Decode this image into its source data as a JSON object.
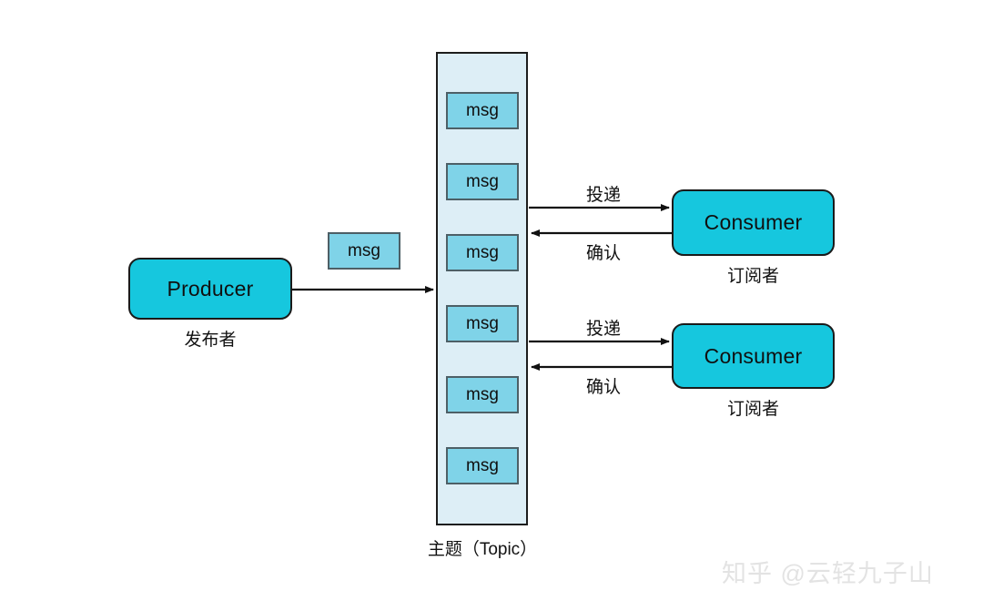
{
  "diagram": {
    "title": "Publish-Subscribe messaging topic diagram",
    "colors": {
      "node_fill": "#16c7de",
      "node_border": "#1a1a1a",
      "topic_fill": "#ddeef6",
      "topic_border": "#1d1d1d",
      "msg_fill": "#7fd3e8",
      "msg_border": "#4d5f66",
      "arrow": "#111111",
      "background": "#ffffff",
      "watermark": "#e3e3e3"
    }
  },
  "producer": {
    "label": "Producer",
    "caption": "发布者"
  },
  "inflight_message": {
    "label": "msg"
  },
  "topic": {
    "caption": "主题（Topic）",
    "messages": [
      {
        "label": "msg"
      },
      {
        "label": "msg"
      },
      {
        "label": "msg"
      },
      {
        "label": "msg"
      },
      {
        "label": "msg"
      },
      {
        "label": "msg"
      }
    ]
  },
  "consumers": [
    {
      "label": "Consumer",
      "caption": "订阅者",
      "deliver_label": "投递",
      "ack_label": "确认"
    },
    {
      "label": "Consumer",
      "caption": "订阅者",
      "deliver_label": "投递",
      "ack_label": "确认"
    }
  ],
  "watermark": {
    "text": "知乎 @云轻九子山"
  }
}
